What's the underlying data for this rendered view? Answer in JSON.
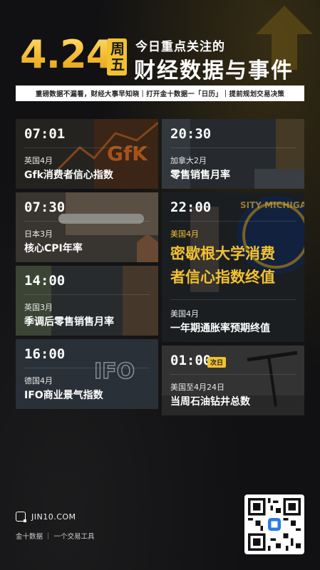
{
  "header": {
    "date": "4.24",
    "weekday": "周五",
    "subtitle": "今日重点关注的",
    "headline": "财经数据与事件",
    "banner": "重磅数据不漏看，财经大事早知晓｜打开金十数据一「日历」｜提前规划交易决策"
  },
  "events": [
    {
      "time": "07:01",
      "region": "英国4月",
      "title": "Gfk消费者信心指数",
      "art_text": "GfK"
    },
    {
      "time": "20:30",
      "region": "加拿大2月",
      "title": "零售销售月率"
    },
    {
      "time": "07:30",
      "region": "日本3月",
      "title": "核心CPI年率"
    },
    {
      "time": "22:00",
      "region": "美国4月",
      "title_line1": "密歇根大学消费",
      "title_line2": "者信心指数终值",
      "region2": "美国4月",
      "title2": "一年期通胀率预期终值",
      "art_text": "SITY MICHIGA"
    },
    {
      "time": "14:00",
      "region": "英国3月",
      "title": "季调后零售销售月率"
    },
    {
      "time": "16:00",
      "region": "德国4月",
      "title": "IFO商业景气指数",
      "art_text": "IFO"
    },
    {
      "time": "01:00",
      "tag": "次日",
      "region": "美国至4月24日",
      "title": "当周石油钻井总数"
    }
  ],
  "footer": {
    "site": "JIN10.COM",
    "slogan": "金十数据 ｜ 一个交易工具"
  },
  "colors": {
    "accent": "#f2c132",
    "background": "#111113",
    "card": "#2c2d31"
  }
}
